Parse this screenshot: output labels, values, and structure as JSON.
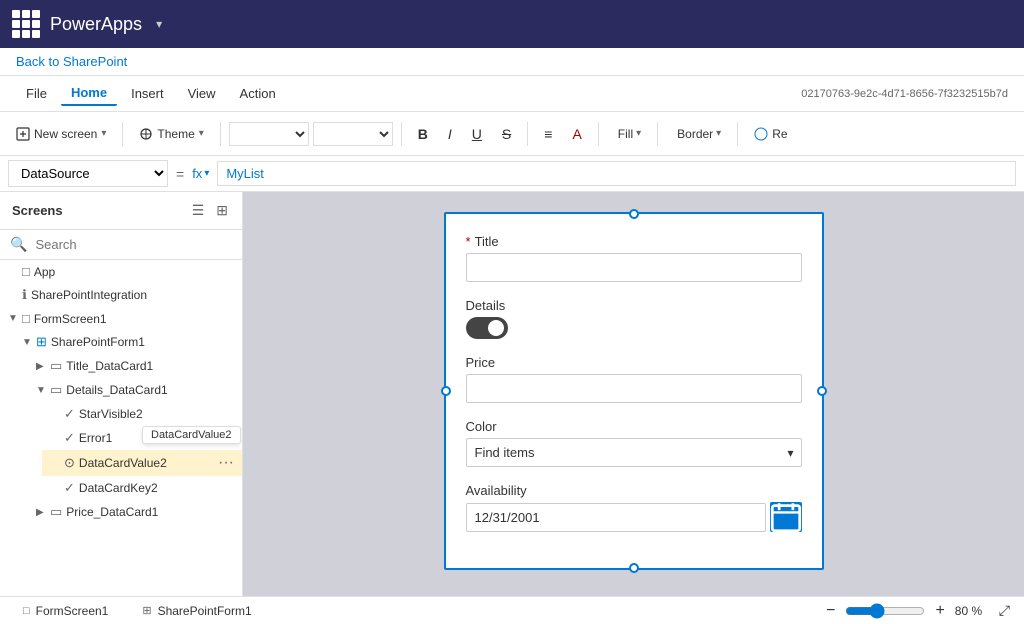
{
  "titleBar": {
    "appName": "PowerApps",
    "chevron": "▾"
  },
  "breadcrumb": {
    "label": "Back to SharePoint",
    "link": "#"
  },
  "menuBar": {
    "items": [
      "File",
      "Home",
      "Insert",
      "View",
      "Action"
    ],
    "activeItem": "Home",
    "instanceId": "02170763-9e2c-4d71-8656-7f3232515b7d"
  },
  "toolbar": {
    "newScreenLabel": "New screen",
    "themeLabel": "Theme",
    "fillLabel": "Fill",
    "borderLabel": "Border",
    "reLabel": "Re"
  },
  "formulaBar": {
    "selectorValue": "DataSource",
    "equalsSign": "=",
    "fxLabel": "fx",
    "formulaValue": "MyList"
  },
  "sidebar": {
    "title": "Screens",
    "searchPlaceholder": "Search",
    "items": [
      {
        "id": "app",
        "label": "App",
        "level": 0,
        "type": "app",
        "expanded": false
      },
      {
        "id": "sharepoint-integration",
        "label": "SharePointIntegration",
        "level": 0,
        "type": "info",
        "expanded": false
      },
      {
        "id": "formscreen1",
        "label": "FormScreen1",
        "level": 0,
        "type": "screen",
        "expanded": true,
        "chevron": "▼"
      },
      {
        "id": "sharepointform1",
        "label": "SharePointForm1",
        "level": 1,
        "type": "form",
        "expanded": true,
        "chevron": "▼"
      },
      {
        "id": "title-datacard1",
        "label": "Title_DataCard1",
        "level": 2,
        "type": "card",
        "expanded": false,
        "chevron": "▶"
      },
      {
        "id": "details-datacard1",
        "label": "Details_DataCard1",
        "level": 2,
        "type": "card",
        "expanded": true,
        "chevron": "▼"
      },
      {
        "id": "starvisible2",
        "label": "StarVisible2",
        "level": 3,
        "type": "check",
        "expanded": false
      },
      {
        "id": "error1",
        "label": "Error1",
        "level": 3,
        "type": "check",
        "expanded": false
      },
      {
        "id": "datacardvalue2",
        "label": "DataCardValue2",
        "level": 3,
        "type": "toggle",
        "expanded": false,
        "selected": true
      },
      {
        "id": "datacardkey2",
        "label": "DataCardKey2",
        "level": 3,
        "type": "check",
        "expanded": false
      },
      {
        "id": "price-datacard1",
        "label": "Price_DataCard1",
        "level": 2,
        "type": "card",
        "expanded": false,
        "chevron": "▶"
      }
    ],
    "tooltip": "DataCardValue2"
  },
  "canvas": {
    "form": {
      "fields": [
        {
          "id": "title",
          "label": "Title",
          "required": true,
          "type": "text",
          "value": ""
        },
        {
          "id": "details",
          "label": "Details",
          "required": false,
          "type": "toggle",
          "value": "on"
        },
        {
          "id": "price",
          "label": "Price",
          "required": false,
          "type": "text",
          "value": ""
        },
        {
          "id": "color",
          "label": "Color",
          "required": false,
          "type": "select",
          "value": "Find items"
        },
        {
          "id": "availability",
          "label": "Availability",
          "required": false,
          "type": "date",
          "value": "12/31/2001"
        }
      ]
    }
  },
  "statusBar": {
    "tabs": [
      {
        "id": "formscreen1",
        "label": "FormScreen1",
        "icon": "□"
      },
      {
        "id": "sharepointform1",
        "label": "SharePointForm1",
        "icon": "⊞"
      }
    ],
    "zoom": {
      "decreaseLabel": "−",
      "increaseLabel": "+",
      "level": "80 %",
      "value": 80
    }
  }
}
